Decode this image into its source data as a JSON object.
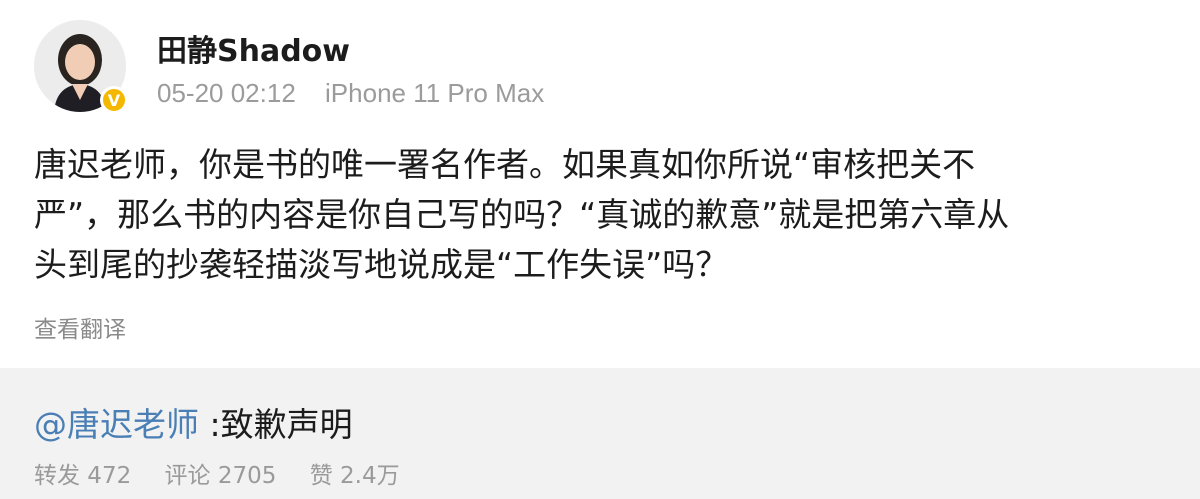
{
  "post": {
    "author": "田静Shadow",
    "time": "05-20 02:12",
    "device": "iPhone 11 Pro Max",
    "verified_badge": "V",
    "lines": [
      "唐迟老师，你是书的唯一署名作者。如果真如你所说“审核把关不",
      "严”，那么书的内容是你自己写的吗？“真诚的歉意”就是把第六章从",
      "头到尾的抄袭轻描淡写地说成是“工作失误”吗？"
    ],
    "translate_label": "查看翻译"
  },
  "repost": {
    "mention": "@唐迟老师",
    "text": " :致歉声明",
    "stats": {
      "repost": "转发 472",
      "comment": "评论 2705",
      "like": "赞 2.4万"
    }
  },
  "colors": {
    "mention": "#4a7fb5",
    "verified": "#f5b800",
    "repost_bg": "#f2f2f2"
  }
}
